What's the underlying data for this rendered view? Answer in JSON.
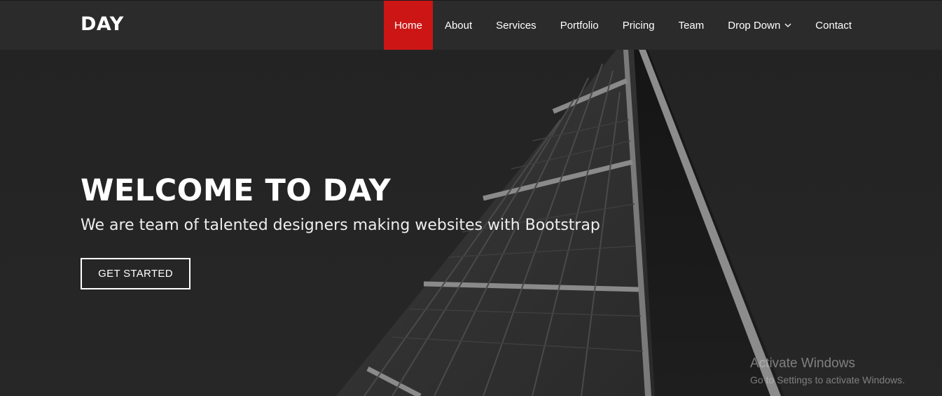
{
  "header": {
    "logo": "DAY",
    "nav": {
      "home": "Home",
      "about": "About",
      "services": "Services",
      "portfolio": "Portfolio",
      "pricing": "Pricing",
      "team": "Team",
      "dropdown": "Drop Down",
      "contact": "Contact"
    },
    "active_item": "Home",
    "dropdown_icon": "chevron-down-icon"
  },
  "hero": {
    "title": "WELCOME TO DAY",
    "subtitle": "We are team of talented designers making websites with Bootstrap",
    "cta_label": "GET STARTED"
  },
  "watermark": {
    "title": "Activate Windows",
    "subtitle": "Go to Settings to activate Windows."
  },
  "colors": {
    "accent": "#cc1616",
    "header_bg": "#2b2b2b",
    "hero_bg": "#262626",
    "text": "#ffffff"
  }
}
